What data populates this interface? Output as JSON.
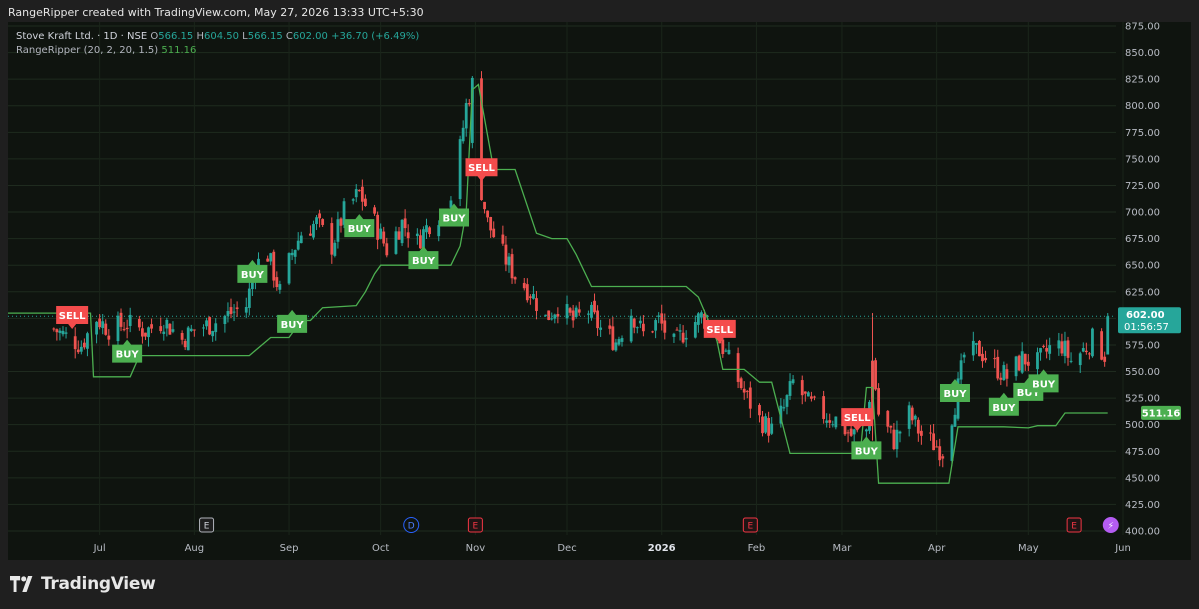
{
  "header": {
    "caption": "RangeRipper created with TradingView.com, May 27, 2026 13:33 UTC+5:30"
  },
  "legend": {
    "symbol": "Stove Kraft Ltd. · 1D · NSE",
    "o_label": "O",
    "o_value": "566.15",
    "h_label": "H",
    "h_value": "604.50",
    "l_label": "L",
    "l_value": "566.15",
    "c_label": "C",
    "c_value": "602.00",
    "change": "+36.70 (+6.49%)",
    "indicator_name": "RangeRipper",
    "indicator_params": "(20, 2, 20, 1.5)",
    "indicator_value": "511.16"
  },
  "brand": {
    "name": "TradingView"
  },
  "colors": {
    "up": "#26a69a",
    "down": "#ef5350",
    "line": "#4caf50",
    "buy": "#4caf50",
    "sell": "#f44c4c",
    "background": "#0f140f"
  },
  "chart_data": {
    "type": "candlestick",
    "title": "Stove Kraft Ltd. · 1D · NSE",
    "ylim": [
      400,
      875
    ],
    "y_ticks": [
      "875.00",
      "850.00",
      "825.00",
      "800.00",
      "775.00",
      "750.00",
      "725.00",
      "700.00",
      "675.00",
      "650.00",
      "625.00",
      "600.00",
      "575.00",
      "550.00",
      "525.00",
      "500.00",
      "475.00",
      "450.00",
      "425.00",
      "400.00"
    ],
    "x_ticks": [
      "Jul",
      "Aug",
      "Sep",
      "Oct",
      "Nov",
      "Dec",
      "2026",
      "Feb",
      "Mar",
      "Apr",
      "May",
      "Jun"
    ],
    "price_label": {
      "value": "602.00",
      "countdown": "01:56:57"
    },
    "indicator_label": {
      "value": "511.16"
    },
    "close_path": [
      [
        "2025-06-16",
        590
      ],
      [
        "2025-06-20",
        583
      ],
      [
        "2025-06-25",
        575
      ],
      [
        "2025-06-30",
        600
      ],
      [
        "2025-07-04",
        590
      ],
      [
        "2025-07-10",
        595
      ],
      [
        "2025-07-16",
        588
      ],
      [
        "2025-07-22",
        598
      ],
      [
        "2025-07-28",
        580
      ],
      [
        "2025-08-01",
        590
      ],
      [
        "2025-08-07",
        595
      ],
      [
        "2025-08-13",
        605
      ],
      [
        "2025-08-18",
        612
      ],
      [
        "2025-08-21",
        650
      ],
      [
        "2025-08-25",
        660
      ],
      [
        "2025-08-29",
        625
      ],
      [
        "2025-09-02",
        662
      ],
      [
        "2025-09-05",
        680
      ],
      [
        "2025-09-10",
        690
      ],
      [
        "2025-09-15",
        668
      ],
      [
        "2025-09-19",
        700
      ],
      [
        "2025-09-24",
        718
      ],
      [
        "2025-09-29",
        690
      ],
      [
        "2025-10-03",
        665
      ],
      [
        "2025-10-08",
        690
      ],
      [
        "2025-10-13",
        672
      ],
      [
        "2025-10-17",
        690
      ],
      [
        "2025-10-21",
        700
      ],
      [
        "2025-10-24",
        715
      ],
      [
        "2025-10-27",
        760
      ],
      [
        "2025-10-29",
        800
      ],
      [
        "2025-10-31",
        820
      ],
      [
        "2025-11-03",
        720
      ],
      [
        "2025-11-05",
        690
      ],
      [
        "2025-11-10",
        660
      ],
      [
        "2025-11-14",
        640
      ],
      [
        "2025-11-19",
        625
      ],
      [
        "2025-11-24",
        600
      ],
      [
        "2025-11-28",
        612
      ],
      [
        "2025-12-03",
        598
      ],
      [
        "2025-12-08",
        607
      ],
      [
        "2025-12-12",
        590
      ],
      [
        "2025-12-17",
        578
      ],
      [
        "2025-12-22",
        606
      ],
      [
        "2025-12-26",
        585
      ],
      [
        "2025-12-31",
        598
      ],
      [
        "2026-01-05",
        575
      ],
      [
        "2026-01-09",
        590
      ],
      [
        "2026-01-14",
        602
      ],
      [
        "2026-01-19",
        585
      ],
      [
        "2026-01-23",
        560
      ],
      [
        "2026-01-28",
        530
      ],
      [
        "2026-02-02",
        505
      ],
      [
        "2026-02-06",
        495
      ],
      [
        "2026-02-10",
        515
      ],
      [
        "2026-02-13",
        540
      ],
      [
        "2026-02-18",
        520
      ],
      [
        "2026-02-23",
        510
      ],
      [
        "2026-02-27",
        505
      ],
      [
        "2026-03-04",
        490
      ],
      [
        "2026-03-09",
        495
      ],
      [
        "2026-03-11",
        560
      ],
      [
        "2026-03-13",
        510
      ],
      [
        "2026-03-18",
        485
      ],
      [
        "2026-03-23",
        510
      ],
      [
        "2026-03-27",
        490
      ],
      [
        "2026-04-01",
        480
      ],
      [
        "2026-04-03",
        475
      ],
      [
        "2026-04-07",
        520
      ],
      [
        "2026-04-10",
        565
      ],
      [
        "2026-04-15",
        570
      ],
      [
        "2026-04-20",
        555
      ],
      [
        "2026-04-24",
        545
      ],
      [
        "2026-04-29",
        562
      ],
      [
        "2026-05-04",
        558
      ],
      [
        "2026-05-08",
        572
      ],
      [
        "2026-05-12",
        575
      ],
      [
        "2026-05-15",
        560
      ],
      [
        "2026-05-19",
        570
      ],
      [
        "2026-05-22",
        580
      ],
      [
        "2026-05-26",
        566
      ],
      [
        "2026-05-27",
        602
      ]
    ],
    "signals": [
      {
        "type": "SELL",
        "date": "2025-06-22",
        "price": 590
      },
      {
        "type": "BUY",
        "date": "2025-07-10",
        "price": 580
      },
      {
        "type": "BUY",
        "date": "2025-08-20",
        "price": 655
      },
      {
        "type": "BUY",
        "date": "2025-09-02",
        "price": 608
      },
      {
        "type": "BUY",
        "date": "2025-09-24",
        "price": 698
      },
      {
        "type": "BUY",
        "date": "2025-10-15",
        "price": 668
      },
      {
        "type": "BUY",
        "date": "2025-10-25",
        "price": 708
      },
      {
        "type": "SELL",
        "date": "2025-11-03",
        "price": 729
      },
      {
        "type": "SELL",
        "date": "2026-01-20",
        "price": 577
      },
      {
        "type": "SELL",
        "date": "2026-03-06",
        "price": 494
      },
      {
        "type": "BUY",
        "date": "2026-03-09",
        "price": 489
      },
      {
        "type": "BUY",
        "date": "2026-04-07",
        "price": 543
      },
      {
        "type": "BUY",
        "date": "2026-04-23",
        "price": 530
      },
      {
        "type": "BUY",
        "date": "2026-05-01",
        "price": 544
      },
      {
        "type": "BUY",
        "date": "2026-05-06",
        "price": 552
      }
    ],
    "trailing_line": [
      [
        "2025-06-01",
        605
      ],
      [
        "2025-06-28",
        605
      ],
      [
        "2025-06-29",
        545
      ],
      [
        "2025-07-11",
        545
      ],
      [
        "2025-07-14",
        565
      ],
      [
        "2025-08-19",
        565
      ],
      [
        "2025-08-26",
        582
      ],
      [
        "2025-09-01",
        582
      ],
      [
        "2025-09-05",
        598
      ],
      [
        "2025-09-08",
        598
      ],
      [
        "2025-09-12",
        610
      ],
      [
        "2025-09-23",
        612
      ],
      [
        "2025-09-26",
        625
      ],
      [
        "2025-09-29",
        642
      ],
      [
        "2025-10-01",
        650
      ],
      [
        "2025-10-24",
        650
      ],
      [
        "2025-10-27",
        668
      ],
      [
        "2025-10-29",
        700
      ],
      [
        "2025-10-31",
        815
      ],
      [
        "2025-11-02",
        820
      ],
      [
        "2025-11-07",
        740
      ],
      [
        "2025-11-14",
        740
      ],
      [
        "2025-11-21",
        680
      ],
      [
        "2025-11-26",
        675
      ],
      [
        "2025-12-01",
        675
      ],
      [
        "2025-12-04",
        660
      ],
      [
        "2025-12-09",
        630
      ],
      [
        "2026-01-09",
        630
      ],
      [
        "2026-01-13",
        620
      ],
      [
        "2026-01-16",
        600
      ],
      [
        "2026-01-19",
        580
      ],
      [
        "2026-01-21",
        552
      ],
      [
        "2026-01-28",
        552
      ],
      [
        "2026-02-02",
        540
      ],
      [
        "2026-02-06",
        540
      ],
      [
        "2026-02-12",
        473
      ],
      [
        "2026-03-07",
        473
      ],
      [
        "2026-03-09",
        535
      ],
      [
        "2026-03-11",
        535
      ],
      [
        "2026-03-13",
        445
      ],
      [
        "2026-04-05",
        445
      ],
      [
        "2026-04-08",
        498
      ],
      [
        "2026-04-23",
        498
      ],
      [
        "2026-05-01",
        497
      ],
      [
        "2026-05-04",
        499
      ],
      [
        "2026-05-10",
        499
      ],
      [
        "2026-05-13",
        511
      ],
      [
        "2026-05-27",
        511
      ]
    ],
    "event_markers": [
      {
        "letter": "E",
        "date": "2025-08-05",
        "style": "gray"
      },
      {
        "letter": "D",
        "date": "2025-10-11",
        "style": "blue"
      },
      {
        "letter": "E",
        "date": "2025-11-01",
        "style": "red"
      },
      {
        "letter": "E",
        "date": "2026-01-30",
        "style": "red"
      },
      {
        "letter": "E",
        "date": "2026-05-16",
        "style": "red"
      },
      {
        "letter": "⚡",
        "date": "2026-05-28",
        "style": "purple"
      }
    ]
  }
}
